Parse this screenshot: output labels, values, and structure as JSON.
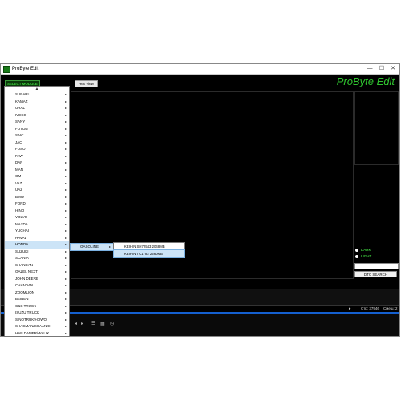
{
  "window": {
    "title": "ProByte Edit",
    "controls": {
      "minimize": "—",
      "maximize": "☐",
      "close": "✕"
    }
  },
  "toolbar_top": {
    "select_module": "SELECT MODULE",
    "hex_view": "Hex View",
    "brand": "ProByte Edit"
  },
  "theme": {
    "dark_label": "DARK",
    "light_label": "LIGHT",
    "accent": "#2fc42f"
  },
  "dtc": {
    "search_label": "DTC SEARCH",
    "input_value": ""
  },
  "status": {
    "position": "Стр: 37946",
    "lines": "Смещ: 2"
  },
  "menu": {
    "scroll_up": "▲",
    "items": [
      "SUBARU",
      "KAMAZ",
      "URAL",
      "IVECO",
      "SANY",
      "FOTON",
      "SAIC",
      "JAC",
      "FUSO",
      "FAW",
      "DAF",
      "MAN",
      "GM",
      "VAZ",
      "UAZ",
      "BMW",
      "FORD",
      "HINO",
      "VOLVO",
      "MAZDA",
      "YUCHAI",
      "HAVAL",
      "HONDA",
      "SUZUKI",
      "SCANIA",
      "SHANDAN",
      "GAZEL NEXT",
      "JOHN DEERE",
      "CHANDAN",
      "ZOOMLION",
      "BEIBEN",
      "C&C TRUCK",
      "ISUZU TRUCK",
      "SINOTRUK/HOWO",
      "SHACMAN/SHAANXI",
      "HAN DAMER/WALIX"
    ],
    "highlighted": "HONDA",
    "arrow": "▸"
  },
  "submenu1": {
    "items": [
      "GASOLINE"
    ]
  },
  "submenu2": {
    "items": [
      "KEIHIN SH72543 2048MB",
      "KEIHIN TC1782 2560MB"
    ],
    "highlighted": "KEIHIN TC1782 2560MB"
  }
}
